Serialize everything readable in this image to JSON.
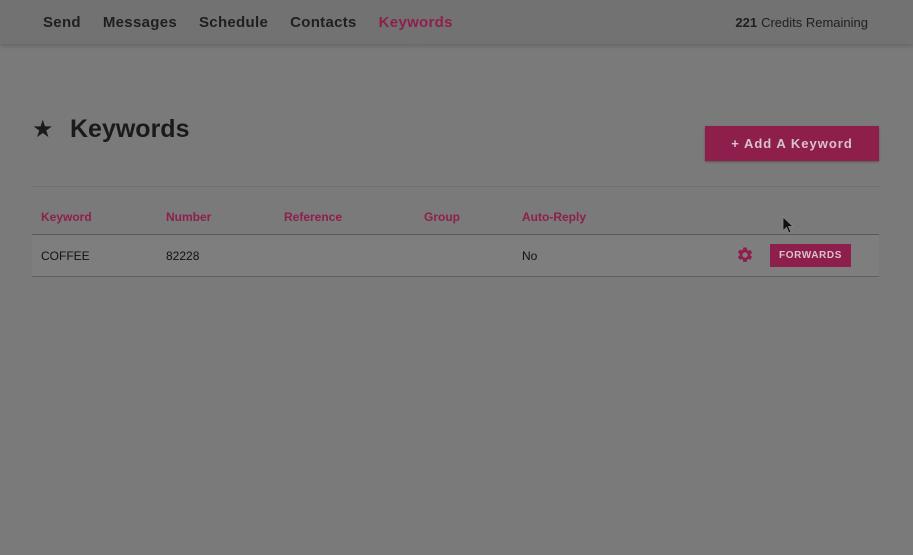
{
  "nav": {
    "items": [
      {
        "label": "Send"
      },
      {
        "label": "Messages"
      },
      {
        "label": "Schedule"
      },
      {
        "label": "Contacts"
      },
      {
        "label": "Keywords"
      }
    ],
    "active": "Keywords"
  },
  "credits": {
    "count": "221",
    "label": "Credits Remaining"
  },
  "page": {
    "icon": "star-icon",
    "title": "Keywords",
    "add_button_label": "+ Add A Keyword"
  },
  "table": {
    "headers": [
      "Keyword",
      "Number",
      "Reference",
      "Group",
      "Auto-Reply"
    ],
    "rows": [
      {
        "keyword": "COFFEE",
        "number": "82228",
        "reference": "",
        "group": "",
        "auto_reply": "No",
        "settings_icon": "gear-icon",
        "forwards_label": "FORWARDS"
      }
    ]
  },
  "colors": {
    "accent": "#8e1f4d",
    "background": "#7a7a7a",
    "navbar": "#727272"
  }
}
